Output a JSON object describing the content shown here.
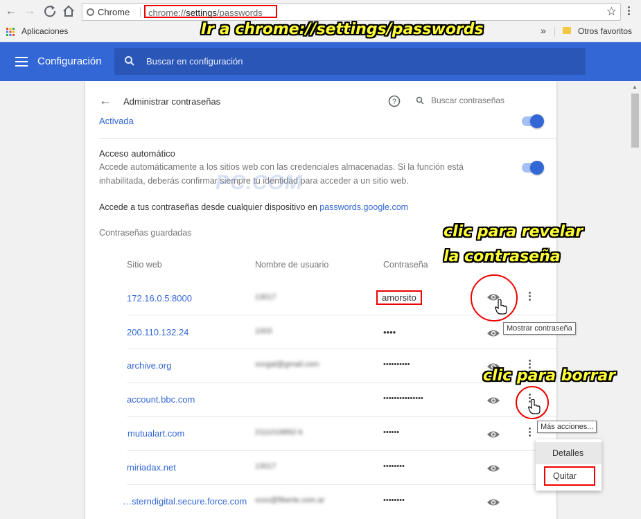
{
  "browser": {
    "site_chip": "Chrome",
    "url_prefix": "chrome://",
    "url_main": "settings",
    "url_suffix": "/passwords",
    "apps_label": "Aplicaciones",
    "more_bookmarks": "»",
    "other_bookmarks": "Otros favoritos"
  },
  "annotations": {
    "go_to": "Ir a chrome://settings/passwords",
    "reveal_line1": "clic para revelar",
    "reveal_line2": "la contraseña",
    "delete": "clic para borrar"
  },
  "header": {
    "title": "Configuración",
    "search_placeholder": "Buscar en configuración"
  },
  "passwords_page": {
    "title": "Administrar contraseñas",
    "search_placeholder": "Buscar contraseñas",
    "offer_status": "Activada",
    "autosignin_title": "Acceso automático",
    "autosignin_desc_line1": "Accede automáticamente a los sitios web con las credenciales almacenadas. Si la función está",
    "autosignin_desc_line2": "inhabilitada, deberás confirmar siempre tu identidad para acceder a un sitio web.",
    "access_text": "Accede a tus contraseñas desde cualquier dispositivo en ",
    "access_link": "passwords.google.com",
    "saved_heading": "Contraseñas guardadas",
    "col_site": "Sitio web",
    "col_user": "Nombre de usuario",
    "col_password": "Contraseña",
    "rows": [
      {
        "site": "172.16.0.5:8000",
        "user": "13017",
        "password": "amorsito"
      },
      {
        "site": "200.110.132.24",
        "user": "1003",
        "password": "••••"
      },
      {
        "site": "archive.org",
        "user": "xxxgal@gmail.com",
        "password": "••••••••••"
      },
      {
        "site": "account.bbc.com",
        "user": "",
        "password": "•••••••••••••••"
      },
      {
        "site": "mutualart.com",
        "user": "2111018892-k",
        "password": "••••••"
      },
      {
        "site": "miriadax.net",
        "user": "13017",
        "password": "••••••••"
      },
      {
        "site": "…sterndigital.secure.force.com",
        "user": "xxxx@fiberte.com.ar",
        "password": "••••••••"
      }
    ]
  },
  "tooltips": {
    "show_password": "Mostrar contraseña",
    "more_actions": "Más acciones..."
  },
  "menu": {
    "details": "Detalles",
    "remove": "Quitar"
  },
  "watermark": "PC.COM",
  "colors": {
    "accent": "#3367d6",
    "header": "#3367d6",
    "highlight": "#e00000",
    "annotation": "#ffff33"
  }
}
